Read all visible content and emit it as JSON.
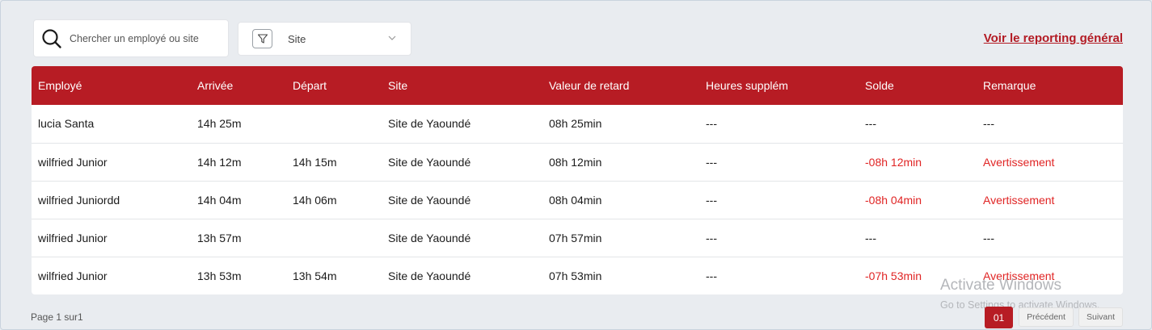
{
  "search": {
    "placeholder": "Chercher un employé ou site"
  },
  "site_filter": {
    "selected": "Site"
  },
  "report_link": "Voir le reporting général",
  "table": {
    "columns": [
      "Employé",
      "Arrivée",
      "Départ",
      "Site",
      "Valeur de retard",
      "Heures supplém",
      "Solde",
      "Remarque"
    ],
    "rows": [
      [
        "lucia Santa",
        "14h 25m",
        "",
        "Site de Yaoundé",
        "08h 25min",
        "---",
        "---",
        "---"
      ],
      [
        "wilfried Junior",
        "14h 12m",
        "14h 15m",
        "Site de Yaoundé",
        "08h 12min",
        "---",
        "-08h 12min",
        "Avertissement"
      ],
      [
        "wilfried Juniordd",
        "14h 04m",
        "14h 06m",
        "Site de Yaoundé",
        "08h 04min",
        "---",
        "-08h 04min",
        "Avertissement"
      ],
      [
        "wilfried Junior",
        "13h 57m",
        "",
        "Site de Yaoundé",
        "07h 57min",
        "---",
        "---",
        "---"
      ],
      [
        "wilfried Junior",
        "13h 53m",
        "13h 54m",
        "Site de Yaoundé",
        "07h 53min",
        "---",
        "-07h 53min",
        "Avertissement"
      ]
    ]
  },
  "pagination": {
    "info": "Page 1 sur1",
    "current_page": "01",
    "prev_label": "Précédent",
    "next_label": "Suivant"
  },
  "watermark": {
    "title": "Activate Windows",
    "subtitle": "Go to Settings to activate Windows."
  },
  "colors": {
    "accent": "#b71c24",
    "negative_text": "#e02424",
    "background": "#e9ecf0"
  },
  "icons": {
    "search": "search-icon",
    "filter": "filter-icon",
    "dropdown": "chevron-down-icon"
  }
}
